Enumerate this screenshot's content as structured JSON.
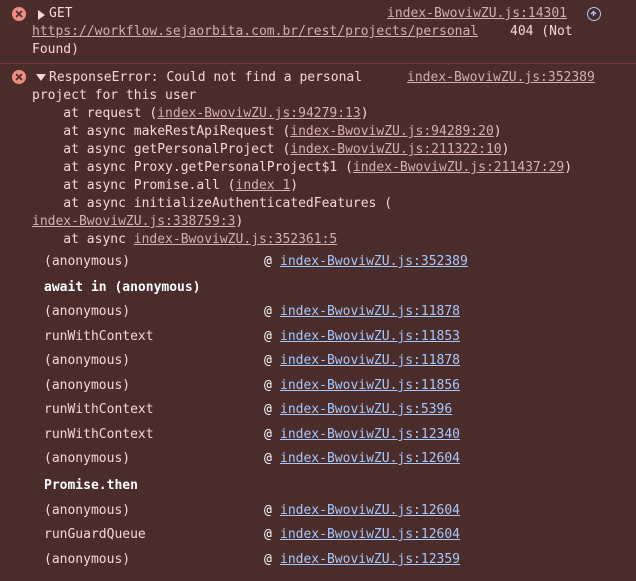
{
  "network_error": {
    "method": "GET",
    "source": "index-BwoviwZU.js:14301",
    "url": "https://workflow.sejaorbita.com.br/rest/projects/personal",
    "status": "404 (Not",
    "status_cont": "Found)"
  },
  "response_error": {
    "source": "index-BwoviwZU.js:352389",
    "message_line1": "ResponseError: Could not find a personal",
    "message_line2": "project for this user",
    "stack": [
      {
        "prefix": "    at request (",
        "link": "index-BwoviwZU.js:94279:13",
        "suffix": ")"
      },
      {
        "prefix": "    at async makeRestApiRequest (",
        "link": "index-BwoviwZU.js:94289:20",
        "suffix": ")"
      },
      {
        "prefix": "    at async getPersonalProject (",
        "link": "index-BwoviwZU.js:211322:10",
        "suffix": ")"
      },
      {
        "prefix": "    at async Proxy.getPersonalProject$1 (",
        "link": "index-BwoviwZU.js:211437:29",
        "suffix": ")"
      },
      {
        "prefix": "    at async Promise.all (",
        "link": "index 1",
        "suffix": ")"
      },
      {
        "prefix": "    at async initializeAuthenticatedFeatures (",
        "link": "",
        "suffix": ""
      },
      {
        "prefix": "",
        "link": "index-BwoviwZU.js:338759:3",
        "suffix": ")"
      },
      {
        "prefix": "    at async ",
        "link": "index-BwoviwZU.js:352361:5",
        "suffix": ""
      }
    ]
  },
  "call_stack": [
    {
      "type": "frame",
      "func": "(anonymous)",
      "at": "@",
      "link": "index-BwoviwZU.js:352389"
    },
    {
      "type": "group",
      "label": "await in (anonymous)"
    },
    {
      "type": "frame",
      "func": "(anonymous)",
      "at": "@",
      "link": "index-BwoviwZU.js:11878"
    },
    {
      "type": "frame",
      "func": "runWithContext",
      "at": "@",
      "link": "index-BwoviwZU.js:11853"
    },
    {
      "type": "frame",
      "func": "(anonymous)",
      "at": "@",
      "link": "index-BwoviwZU.js:11878"
    },
    {
      "type": "frame",
      "func": "(anonymous)",
      "at": "@",
      "link": "index-BwoviwZU.js:11856"
    },
    {
      "type": "frame",
      "func": "runWithContext",
      "at": "@",
      "link": "index-BwoviwZU.js:5396"
    },
    {
      "type": "frame",
      "func": "runWithContext",
      "at": "@",
      "link": "index-BwoviwZU.js:12340"
    },
    {
      "type": "frame",
      "func": "(anonymous)",
      "at": "@",
      "link": "index-BwoviwZU.js:12604"
    },
    {
      "type": "group",
      "label": "Promise.then"
    },
    {
      "type": "frame",
      "func": "(anonymous)",
      "at": "@",
      "link": "index-BwoviwZU.js:12604"
    },
    {
      "type": "frame",
      "func": "runGuardQueue",
      "at": "@",
      "link": "index-BwoviwZU.js:12604"
    },
    {
      "type": "frame",
      "func": "(anonymous)",
      "at": "@",
      "link": "index-BwoviwZU.js:12359"
    }
  ],
  "colors": {
    "background": "#4a2c2b",
    "error_icon": "#f28b82",
    "text": "#f6d7d7",
    "link": "#a8c7fa"
  },
  "icons": {
    "error": "error-circle-icon",
    "expand_right": "caret-right-icon",
    "expand_down": "caret-down-icon",
    "network": "network-request-icon"
  }
}
